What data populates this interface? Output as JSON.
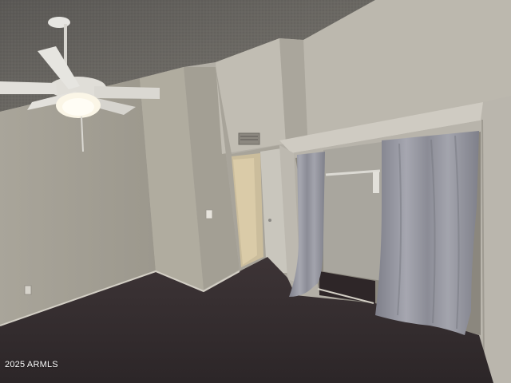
{
  "watermark": "2025 ARMLS",
  "colors": {
    "ceiling": "#6a6762",
    "wall_left": "#a29e93",
    "wall_back": "#b8b5ac",
    "wall_right": "#b1ada4",
    "carpet": "#3b3335",
    "curtain": "#8f8f98",
    "doorway": "#d9c9a4"
  },
  "icons": [
    "ceiling-fan-icon",
    "air-vent-icon",
    "light-switch-icon",
    "power-outlet-icon"
  ]
}
